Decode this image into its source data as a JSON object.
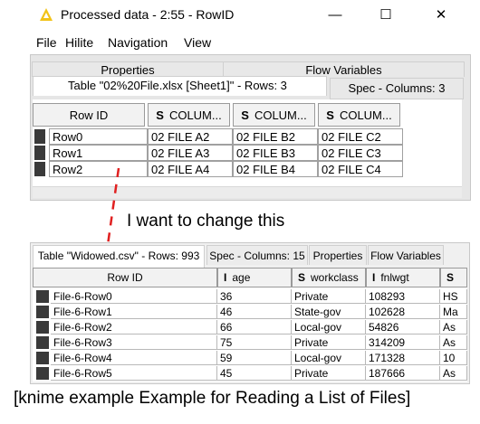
{
  "window1": {
    "title": "Processed data - 2:55 - RowID",
    "controls": {
      "minimize": "—",
      "maximize": "☐",
      "close": "✕"
    },
    "menu": [
      "File",
      "Hilite",
      "Navigation",
      "View"
    ],
    "tabs": {
      "properties": "Properties",
      "flow_variables": "Flow Variables"
    },
    "table_tab": "Table \"02%20File.xlsx [Sheet1]\" - Rows: 3",
    "spec_tab": "Spec - Columns: 3",
    "columns": [
      "Row ID",
      "COLUM...",
      "COLUM...",
      "COLUM..."
    ],
    "type_badge": "S",
    "rows": [
      [
        "Row0",
        "02 FILE A2",
        "02 FILE B2",
        "02 FILE C2"
      ],
      [
        "Row1",
        "02 FILE A3",
        "02 FILE B3",
        "02 FILE C3"
      ],
      [
        "Row2",
        "02 FILE A4",
        "02 FILE B4",
        "02 FILE C4"
      ]
    ]
  },
  "annotation": {
    "text": "I want to change this",
    "arrow_color": "#e02020"
  },
  "window2": {
    "tabs": [
      "Table \"Widowed.csv\" - Rows: 993",
      "Spec - Columns: 15",
      "Properties",
      "Flow Variables"
    ],
    "columns": [
      {
        "label": "Row ID",
        "type": ""
      },
      {
        "label": "age",
        "type": "I"
      },
      {
        "label": "workclass",
        "type": "S"
      },
      {
        "label": "fnlwgt",
        "type": "I"
      },
      {
        "label": "",
        "type": "S"
      }
    ],
    "rows": [
      [
        "File-6-Row0",
        "36",
        "Private",
        "108293",
        "HS"
      ],
      [
        "File-6-Row1",
        "46",
        "State-gov",
        "102628",
        "Ma"
      ],
      [
        "File-6-Row2",
        "66",
        "Local-gov",
        "54826",
        "As"
      ],
      [
        "File-6-Row3",
        "75",
        "Private",
        "314209",
        "As"
      ],
      [
        "File-6-Row4",
        "59",
        "Local-gov",
        "171328",
        "10"
      ],
      [
        "File-6-Row5",
        "45",
        "Private",
        "187666",
        "As"
      ]
    ]
  },
  "caption": "[knime example Example for Reading a List of Files]"
}
